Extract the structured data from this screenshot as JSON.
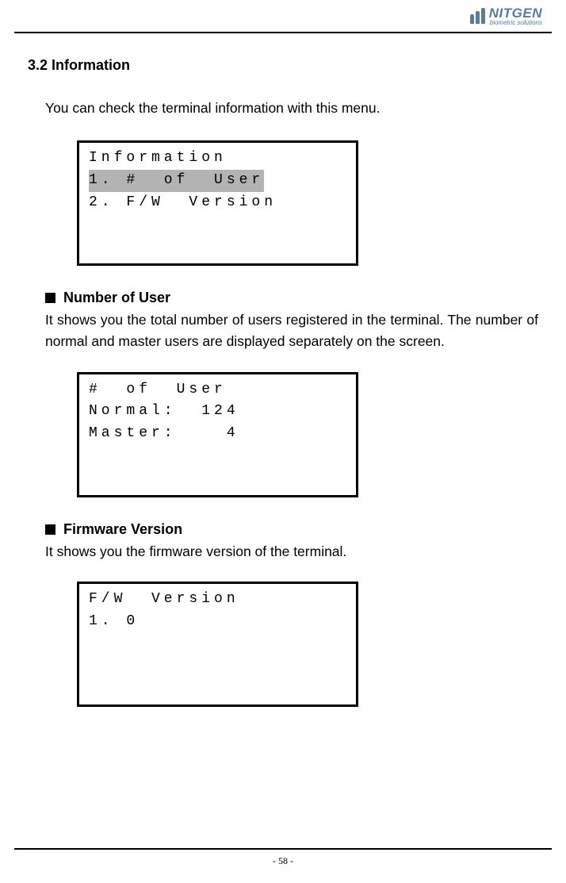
{
  "header": {
    "brand_name": "NITGEN",
    "brand_sub": "biometric solutions"
  },
  "section": {
    "number_title": "3.2  Information",
    "intro": "You can check the terminal information with this menu."
  },
  "lcd1": {
    "line1": "Information",
    "line2": "1. #  of  User",
    "line3": "2. F/W  Version"
  },
  "sub1": {
    "title": "Number of User",
    "body": "It shows you the total number of users registered in the terminal. The number of normal and master users are displayed separately on the screen."
  },
  "lcd2": {
    "line1": "#  of  User",
    "line2": "Normal:  124",
    "line3": "Master:    4"
  },
  "sub2": {
    "title": "Firmware Version",
    "body": "It shows you the firmware version of the terminal."
  },
  "lcd3": {
    "line1": "F/W  Version",
    "line2": "1. 0"
  },
  "footer": {
    "page": "- 58 -"
  }
}
